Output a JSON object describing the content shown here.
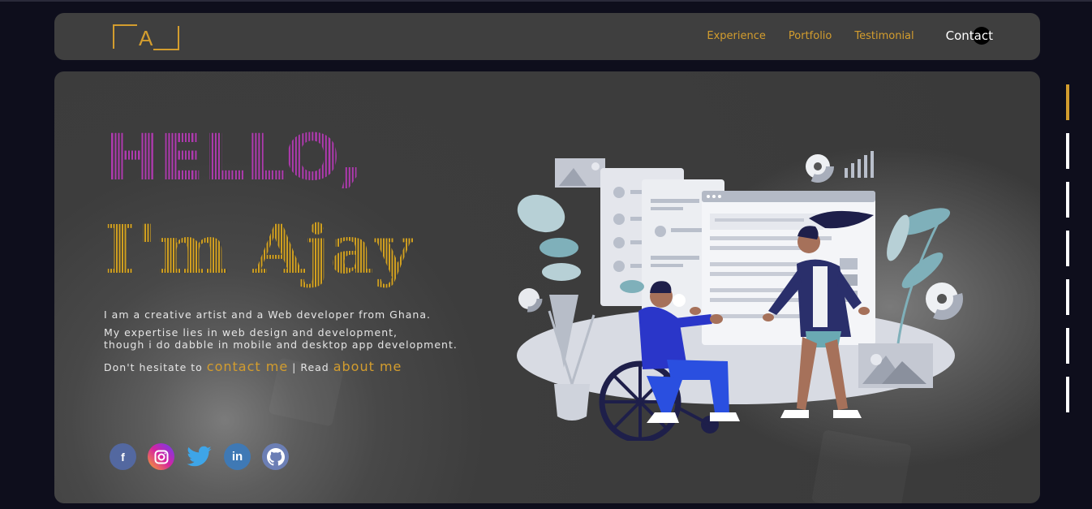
{
  "nav": {
    "logo_letter": "A",
    "links": [
      "Experience",
      "Portfolio",
      "Testimonial"
    ],
    "contact": "Contact"
  },
  "hero": {
    "greeting": "HELLO,",
    "name": "I'm Ajay",
    "line1": "I am a creative artist and a Web developer from Ghana.",
    "line2": "My expertise lies in web design and development,",
    "line3": "though i do dabble in mobile and desktop app development.",
    "cta_prefix": "Don't hesitate to",
    "cta_contact": "contact me",
    "cta_sep": "| Read",
    "cta_about": "about me"
  },
  "socials": [
    {
      "name": "facebook-icon",
      "glyph": "f",
      "color": "#3b5998"
    },
    {
      "name": "instagram-icon",
      "glyph": "◎",
      "color": "#d6249f"
    },
    {
      "name": "twitter-icon",
      "glyph": "🐦",
      "color": "#1da1f2"
    },
    {
      "name": "linkedin-icon",
      "glyph": "in",
      "color": "#0a66c2"
    },
    {
      "name": "github-icon",
      "glyph": "⌥",
      "color": "#6e5494"
    }
  ],
  "colors": {
    "accent": "#d39d2e",
    "hello": "#b03ab0",
    "name": "#d1a020"
  },
  "rail": {
    "active_index": 0,
    "count": 7
  }
}
